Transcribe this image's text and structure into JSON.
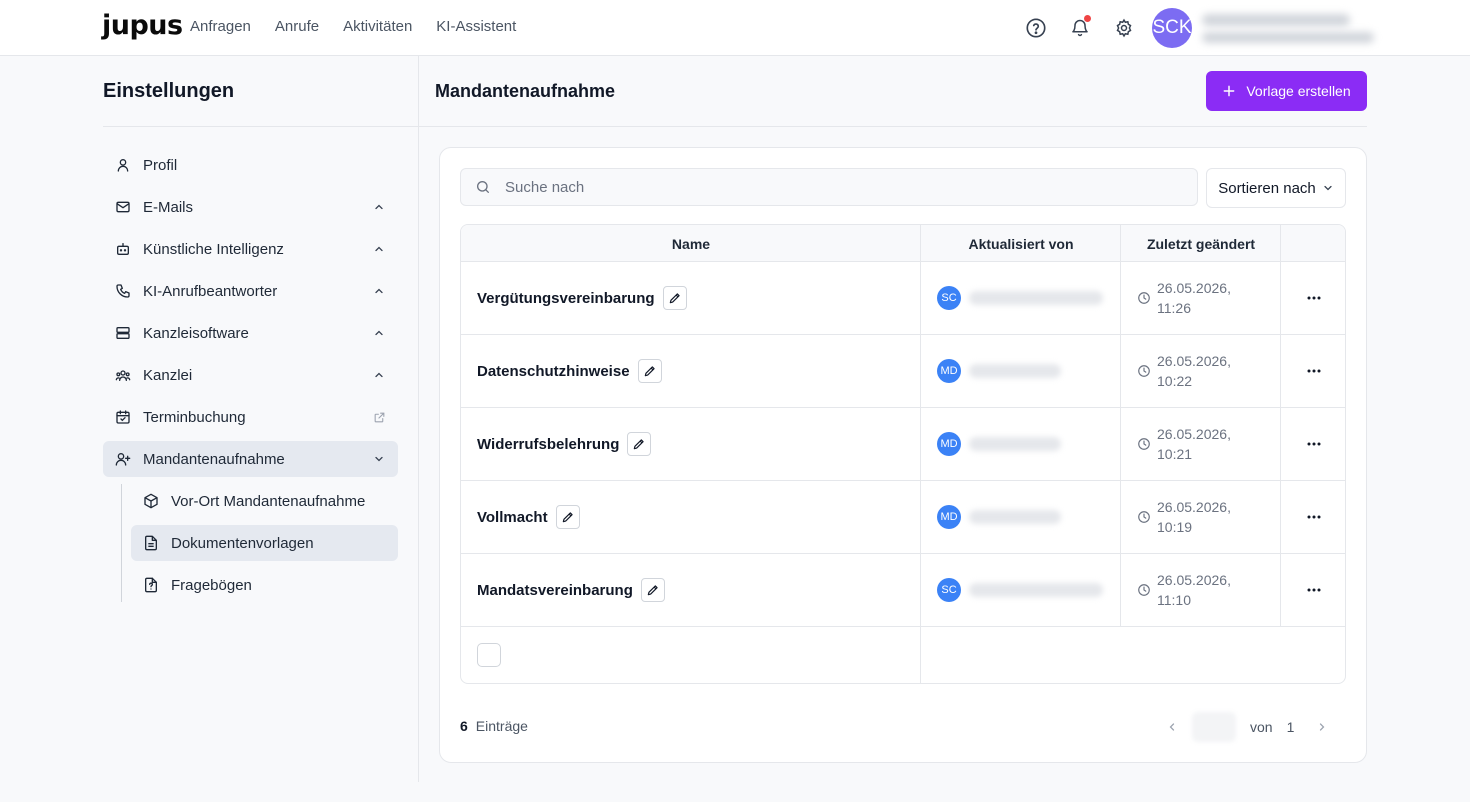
{
  "app": {
    "logo": "jupus",
    "nav": [
      "Anfragen",
      "Anrufe",
      "Aktivitäten",
      "KI-Assistent"
    ],
    "user_initials": "SCK"
  },
  "sidebar": {
    "title": "Einstellungen",
    "items": [
      {
        "label": "Profil",
        "icon": "user-icon"
      },
      {
        "label": "E-Mails",
        "icon": "mail-icon"
      },
      {
        "label": "Künstliche Intelligenz",
        "icon": "bot-icon"
      },
      {
        "label": "KI-Anrufbeantworter",
        "icon": "phone-icon"
      },
      {
        "label": "Kanzleisoftware",
        "icon": "server-icon"
      },
      {
        "label": "Kanzlei",
        "icon": "users-icon"
      },
      {
        "label": "Terminbuchung",
        "icon": "calendar-check-icon"
      },
      {
        "label": "Mandantenaufnahme",
        "icon": "user-plus-icon"
      }
    ],
    "sub_items": [
      {
        "label": "Vor-Ort Mandantenaufnahme",
        "icon": "package-icon"
      },
      {
        "label": "Dokumentenvorlagen",
        "icon": "file-text-icon"
      },
      {
        "label": "Fragebögen",
        "icon": "file-question-icon"
      }
    ]
  },
  "main": {
    "title": "Mandantenaufnahme",
    "create_button": "Vorlage erstellen",
    "search_placeholder": "Suche nach",
    "sort_label": "Sortieren nach",
    "columns": [
      "Name",
      "Aktualisiert von",
      "Zuletzt geändert"
    ],
    "rows": [
      {
        "name": "Vergütungsvereinbarung",
        "initials": "SC",
        "date": "26.05.2026,",
        "time": "11:26"
      },
      {
        "name": "Datenschutzhinweise",
        "initials": "MD",
        "date": "26.05.2026,",
        "time": "10:22"
      },
      {
        "name": "Widerrufsbelehrung",
        "initials": "MD",
        "date": "26.05.2026,",
        "time": "10:21"
      },
      {
        "name": "Vollmacht",
        "initials": "MD",
        "date": "26.05.2026,",
        "time": "10:19"
      },
      {
        "name": "Mandatsvereinbarung",
        "initials": "SC",
        "date": "26.05.2026,",
        "time": "11:10"
      }
    ],
    "footer": {
      "count": "6",
      "count_label": "Einträge",
      "of_label": "von",
      "total_pages": "1"
    }
  }
}
